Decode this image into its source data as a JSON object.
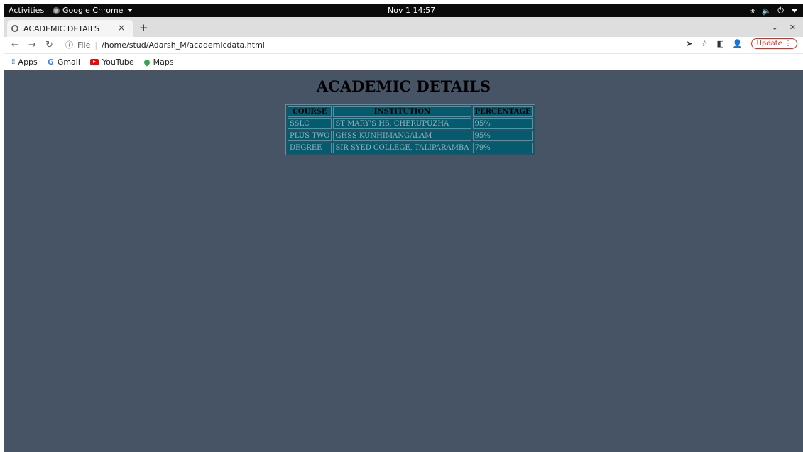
{
  "topbar": {
    "activities": "Activities",
    "app_name": "Google Chrome",
    "clock": "Nov 1  14:57"
  },
  "tab": {
    "title": "ACADEMIC DETAILS",
    "close": "×",
    "new_tab": "+"
  },
  "address": {
    "info_icon": "ⓘ",
    "scheme": "File",
    "path": "/home/stud/Adarsh_M/academicdata.html",
    "update_label": "Update"
  },
  "bookmarks": [
    {
      "label": "Apps",
      "icon": "apps-grid-icon"
    },
    {
      "label": "Gmail",
      "icon": "google-icon"
    },
    {
      "label": "YouTube",
      "icon": "youtube-icon"
    },
    {
      "label": "Maps",
      "icon": "maps-icon"
    }
  ],
  "page": {
    "heading": "ACADEMIC DETAILS",
    "background": "#465465",
    "table": {
      "headers": [
        "COURSE",
        "INSTITUTION",
        "PERCENTAGE"
      ],
      "rows": [
        [
          "SSLC",
          "ST MARY'S HS, CHERUPUZHA",
          "95%"
        ],
        [
          "PLUS TWO",
          "GHSS KUNHIMANGALAM",
          "95%"
        ],
        [
          "DEGREE",
          "SIR SYED COLLEGE, TALIPARAMBA",
          "79%"
        ]
      ]
    }
  }
}
